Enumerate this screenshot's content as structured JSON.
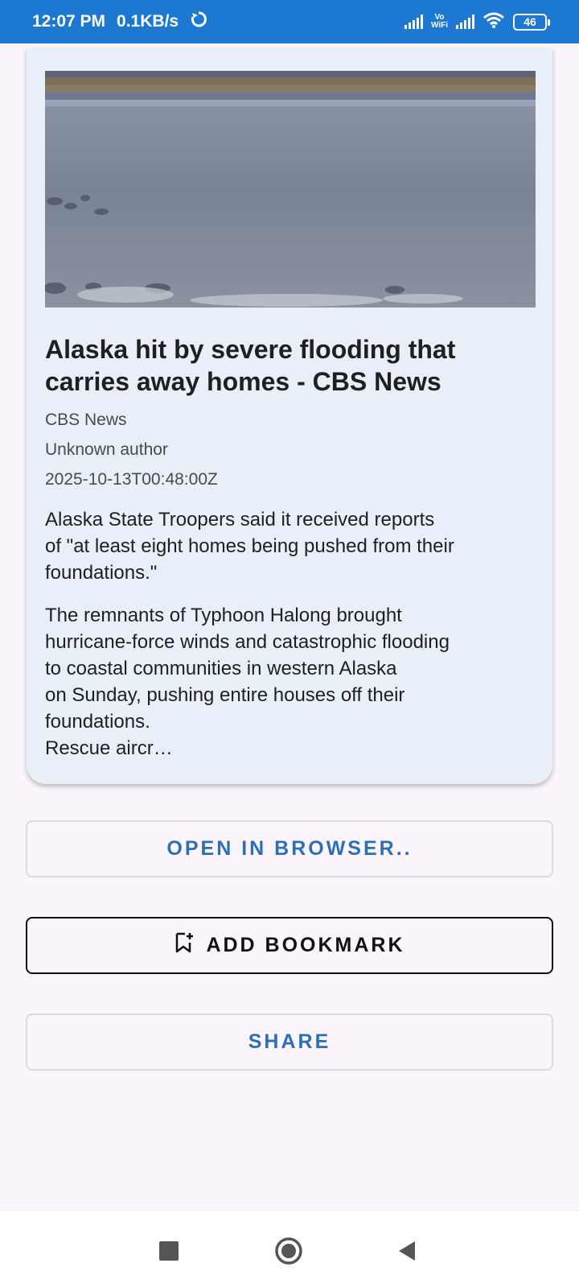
{
  "status_bar": {
    "time": "12:07 PM",
    "speed": "0.1KB/s",
    "vowifi_top": "Vo",
    "vowifi_bottom": "WiFi",
    "battery": "46"
  },
  "article": {
    "image_alt": "river-landscape",
    "title": "Alaska hit by severe flooding that carries away homes - CBS News",
    "source": "CBS News",
    "author": "Unknown author",
    "published": "2025-10-13T00:48:00Z",
    "description": "Alaska State Troopers said it received reports\nof \"at least eight homes being pushed from their\nfoundations.\"",
    "content": "The remnants of Typhoon Halong brought\nhurricane-force winds and catastrophic flooding\nto coastal communities in western Alaska\non Sunday, pushing entire houses off their\nfoundations.\nRescue aircr…"
  },
  "actions": {
    "open_browser": "OPEN IN BROWSER..",
    "add_bookmark": "ADD BOOKMARK",
    "share": "SHARE"
  },
  "colors": {
    "status_bar": "#1d78d2",
    "accent": "#2a6fb8",
    "card": "#e8eff9",
    "background": "#fcf5fb"
  },
  "icons": {
    "bookmark": "bookmark-add-icon",
    "nav_recent": "square-icon",
    "nav_home": "circle-icon",
    "nav_back": "triangle-back-icon"
  }
}
